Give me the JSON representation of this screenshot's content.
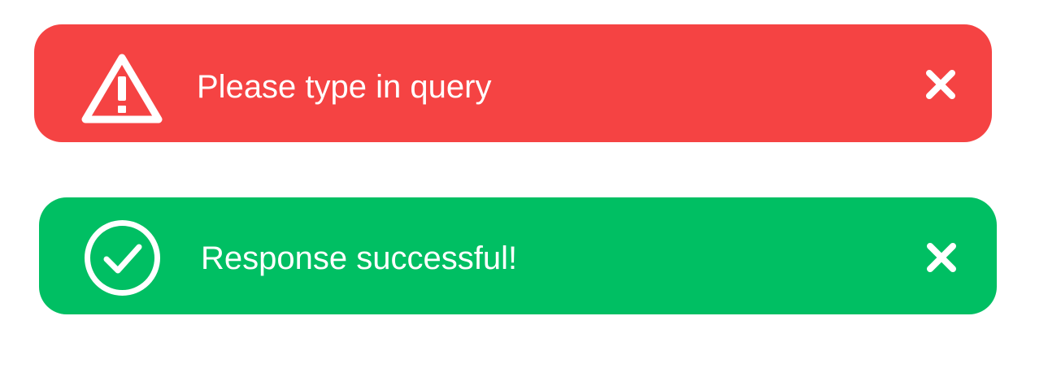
{
  "colors": {
    "error": "#f54343",
    "success": "#00bf63",
    "text": "#ffffff",
    "background": "#ffffff"
  },
  "error_toast": {
    "message": "Please type in query",
    "icon": "warning-triangle-icon",
    "close_icon": "close-icon"
  },
  "success_toast": {
    "message": "Response successful!",
    "icon": "check-circle-icon",
    "close_icon": "close-icon"
  }
}
